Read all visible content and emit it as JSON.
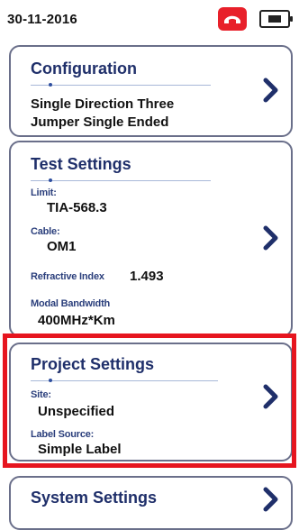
{
  "status": {
    "date": "30-11-2016",
    "phone_icon": "phone-hangup-icon",
    "battery_icon": "battery-icon",
    "accent_color": "#e8202a"
  },
  "configuration": {
    "title": "Configuration",
    "summary_line1": "Single Direction Three",
    "summary_line2": "Jumper Single Ended"
  },
  "test_settings": {
    "title": "Test Settings",
    "limit_label": "Limit:",
    "limit_value": "TIA-568.3",
    "cable_label": "Cable:",
    "cable_value": "OM1",
    "refractive_label": "Refractive Index",
    "refractive_value": "1.493",
    "bandwidth_label": "Modal Bandwidth",
    "bandwidth_value": "400MHz*Km"
  },
  "project_settings": {
    "title": "Project Settings",
    "site_label": "Site:",
    "site_value": "Unspecified",
    "label_source_label": "Label Source:",
    "label_source_value": "Simple Label",
    "highlight_color": "#e6151f"
  },
  "system_settings": {
    "title": "System Settings"
  }
}
